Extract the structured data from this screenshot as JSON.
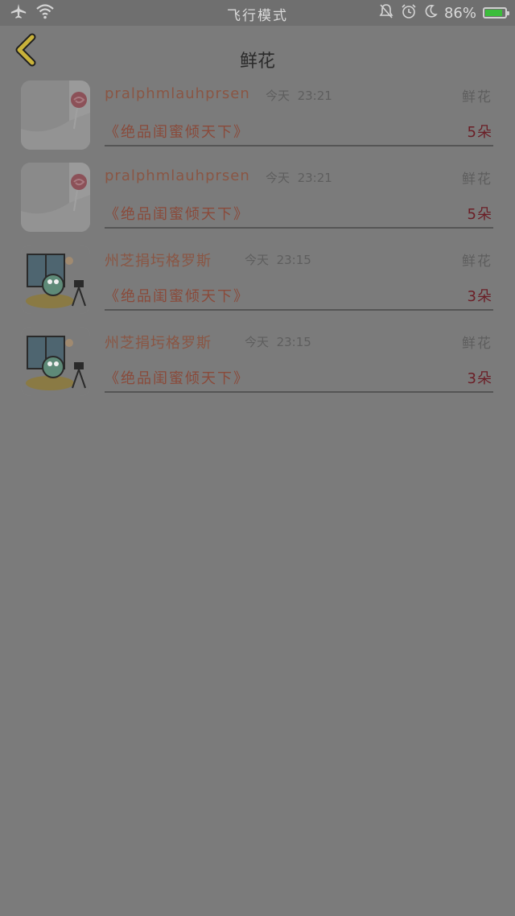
{
  "status_bar": {
    "airplane_icon": "airplane-icon",
    "wifi_icon": "wifi-icon",
    "mode": "飞行模式",
    "battery": "86%",
    "battery_level": 0.86,
    "battery_color": "#3bbd3b"
  },
  "header": {
    "title": "鲜花",
    "back_icon": "chevron-left-icon",
    "back_color": "#c9b23a"
  },
  "list": [
    {
      "avatar": "lollipop-avatar",
      "name": "pralphmlauhprsen",
      "date": "今天",
      "time": "23:21",
      "gift": "鲜花",
      "book": "《绝品闺蜜倾天下》",
      "count": "5朵"
    },
    {
      "avatar": "lollipop-avatar",
      "name": "pralphmlauhprsen",
      "date": "今天",
      "time": "23:21",
      "gift": "鲜花",
      "book": "《绝品闺蜜倾天下》",
      "count": "5朵"
    },
    {
      "avatar": "cartoon-avatar",
      "name": "州芝捐圬格罗斯",
      "date": "今天",
      "time": "23:15",
      "gift": "鲜花",
      "book": "《绝品闺蜜倾天下》",
      "count": "3朵"
    },
    {
      "avatar": "cartoon-avatar",
      "name": "州芝捐圬格罗斯",
      "date": "今天",
      "time": "23:15",
      "gift": "鲜花",
      "book": "《绝品闺蜜倾天下》",
      "count": "3朵"
    }
  ]
}
